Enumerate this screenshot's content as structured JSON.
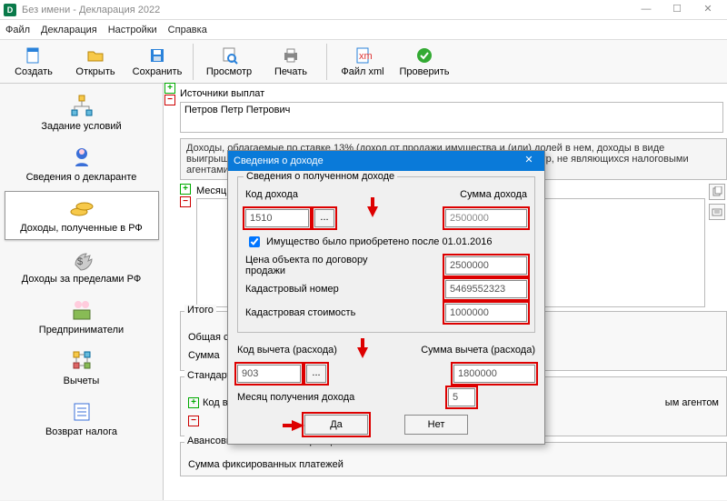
{
  "window": {
    "title": "Без имени - Декларация 2022"
  },
  "menu": {
    "file": "Файл",
    "decl": "Декларация",
    "settings": "Настройки",
    "help": "Справка"
  },
  "toolbar": {
    "create": "Создать",
    "open": "Открыть",
    "save": "Сохранить",
    "view": "Просмотр",
    "print": "Печать",
    "xml": "Файл xml",
    "check": "Проверить"
  },
  "sidebar": {
    "cond": "Задание условий",
    "decl_info": "Сведения о декларанте",
    "income_rf": "Доходы, полученные в РФ",
    "income_abroad": "Доходы за пределами РФ",
    "entrepreneur": "Предприниматели",
    "deductions": "Вычеты",
    "tax_return": "Возврат налога"
  },
  "sources": {
    "header": "Источники выплат",
    "row1": "Петров Петр Петрович"
  },
  "tabs": {
    "main": "Доходы, облагаемые по ставке 13% (доход от продажи имущества и (или) долей в нем, доходы в виде выигрышей, полученных от участников лотерей и организаторов азартных игр, не являющихся налоговыми агентами)"
  },
  "months": {
    "header": "Месяц"
  },
  "totals": {
    "legend": "Итого",
    "total_label": "Общая сумма",
    "sum_label": "Сумма"
  },
  "std": {
    "legend": "Стандартные",
    "code_label": "Код вычета",
    "agent_suffix": "ым агентом"
  },
  "foreigner": {
    "legend": "Авансовые платежи иностранца",
    "sum_label": "Сумма фиксированных платежей"
  },
  "dialog": {
    "title": "Сведения о доходе",
    "group1_legend": "Сведения о полученном доходе",
    "code_label": "Код дохода",
    "code_value": "1510",
    "amount_label": "Сумма дохода",
    "amount_value": "2500000",
    "checkbox": "Имущество было приобретено после 01.01.2016",
    "price_label": "Цена объекта по договору продажи",
    "price_value": "2500000",
    "cadnum_label": "Кадастровый номер",
    "cadnum_value": "5469552323",
    "cadval_label": "Кадастровая стоимость",
    "cadval_value": "1000000",
    "dedcode_label": "Код вычета (расхода)",
    "dedcode_value": "903",
    "dedsum_label": "Сумма вычета (расхода)",
    "dedsum_value": "1800000",
    "month_label": "Месяц получения дохода",
    "month_value": "5",
    "ok": "Да",
    "cancel": "Нет"
  }
}
